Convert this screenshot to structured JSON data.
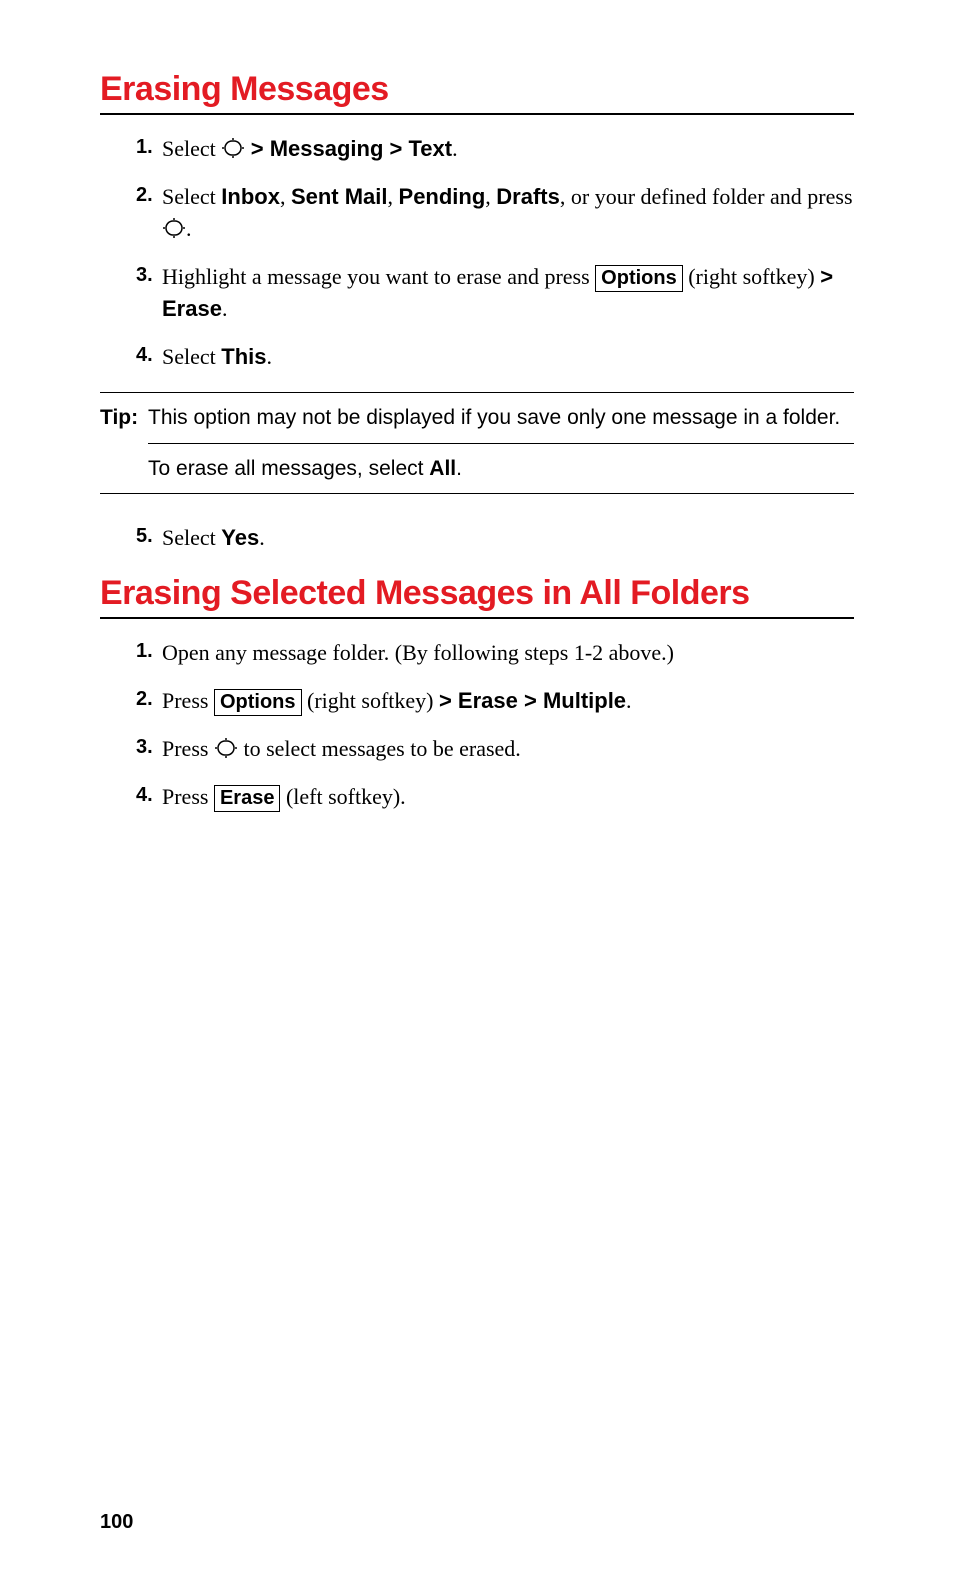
{
  "section1": {
    "heading": "Erasing Messages",
    "steps": [
      {
        "num": "1.",
        "pre": "Select ",
        "icon": true,
        "post1": " ",
        "b1": "> Messaging > Text",
        "post2": "."
      },
      {
        "num": "2.",
        "pre": "Select ",
        "b1": "Inbox",
        "sep1": ", ",
        "b2": "Sent Mail",
        "sep2": ", ",
        "b3": "Pending",
        "sep3": ", ",
        "b4": "Drafts",
        "post1": ", or your defined folder and press ",
        "icon": true,
        "post2": "."
      },
      {
        "num": "3.",
        "pre": "Highlight a message you want to erase and press ",
        "box1": "Options",
        "post1": " (right softkey) ",
        "b1": "> Erase",
        "post2": "."
      },
      {
        "num": "4.",
        "pre": "Select ",
        "b1": "This",
        "post1": "."
      }
    ],
    "tip": {
      "label": "Tip:",
      "text1": "This option may not be displayed if you save only one message in a folder.",
      "text2a": "To erase all messages, select ",
      "text2b": "All",
      "text2c": "."
    },
    "step5": {
      "num": "5.",
      "pre": "Select ",
      "b1": "Yes",
      "post1": "."
    }
  },
  "section2": {
    "heading": "Erasing Selected Messages in All Folders",
    "steps": [
      {
        "num": "1.",
        "pre": "Open any message folder. (By following steps 1-2 above.)"
      },
      {
        "num": "2.",
        "pre": "Press ",
        "box1": "Options",
        "post1": " (right softkey) ",
        "b1": "> Erase > Multiple",
        "post2": "."
      },
      {
        "num": "3.",
        "pre": "Press ",
        "icon": true,
        "post1": " to select messages to be erased."
      },
      {
        "num": "4.",
        "pre": "Press ",
        "box1": "Erase",
        "post1": " (left softkey)."
      }
    ]
  },
  "pageNumber": "100"
}
